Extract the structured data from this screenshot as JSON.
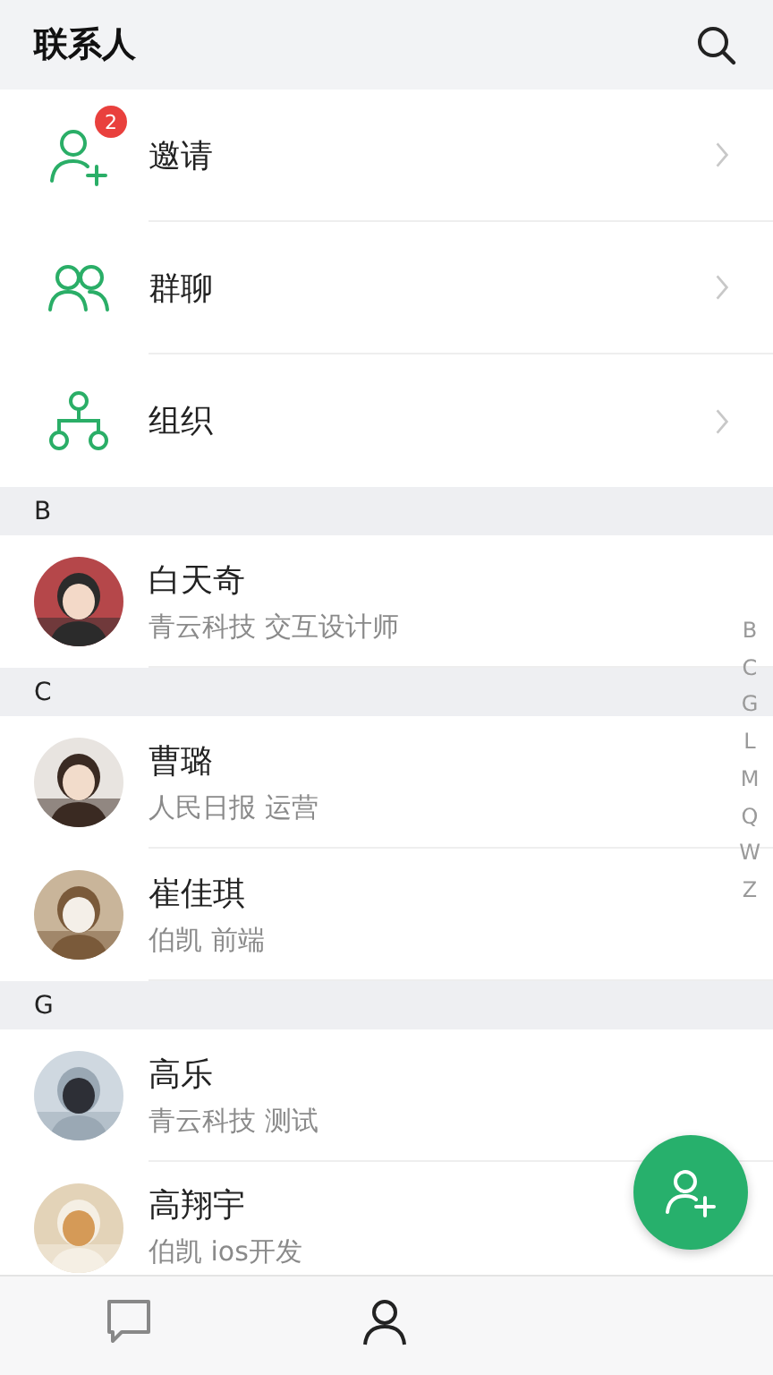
{
  "header": {
    "title": "联系人"
  },
  "menu": [
    {
      "kind": "invite",
      "label": "邀请",
      "badge": "2"
    },
    {
      "kind": "group",
      "label": "群聊"
    },
    {
      "kind": "org",
      "label": "组织"
    }
  ],
  "sections": [
    {
      "letter": "B",
      "contacts": [
        {
          "name": "白天奇",
          "subtitle": "青云科技 交互设计师"
        }
      ]
    },
    {
      "letter": "C",
      "contacts": [
        {
          "name": "曹璐",
          "subtitle": "人民日报 运营"
        },
        {
          "name": "崔佳琪",
          "subtitle": "伯凯 前端"
        }
      ]
    },
    {
      "letter": "G",
      "contacts": [
        {
          "name": "高乐",
          "subtitle": "青云科技 测试"
        },
        {
          "name": "高翔宇",
          "subtitle": "伯凯 ios开发"
        }
      ]
    }
  ],
  "index": [
    "B",
    "C",
    "G",
    "L",
    "M",
    "Q",
    "W",
    "Z"
  ],
  "tabs": [
    {
      "kind": "chat",
      "selected": false
    },
    {
      "kind": "contacts",
      "selected": true
    }
  ]
}
